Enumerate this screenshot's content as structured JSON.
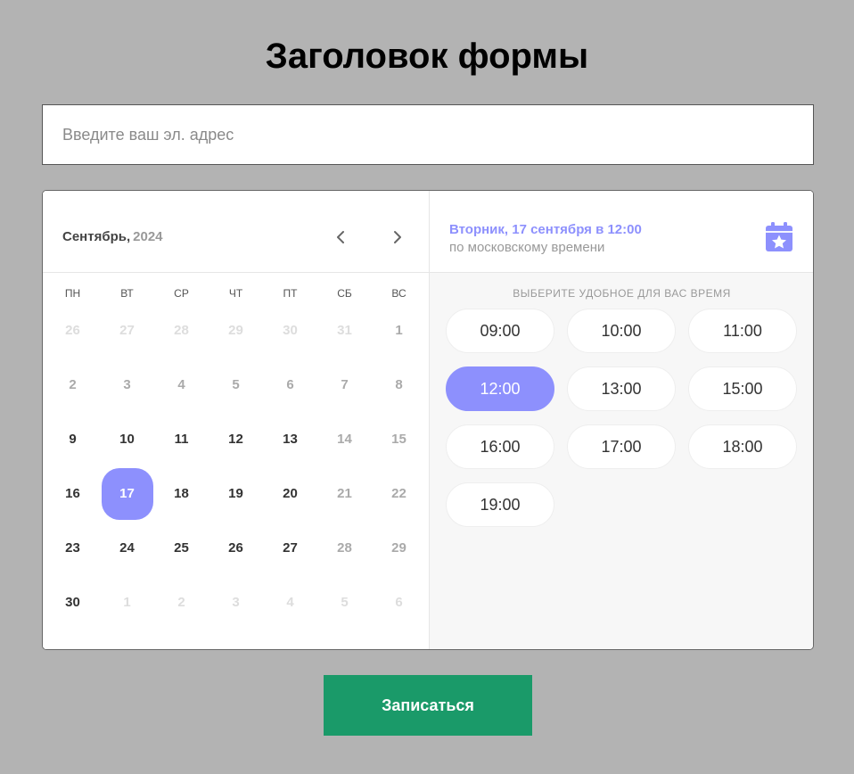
{
  "form": {
    "title": "Заголовок формы",
    "email_placeholder": "Введите ваш эл. адрес",
    "submit_label": "Записаться"
  },
  "calendar": {
    "month": "Сентябрь,",
    "year": "2024",
    "weekdays": [
      "ПН",
      "ВТ",
      "СР",
      "ЧТ",
      "ПТ",
      "СБ",
      "ВС"
    ],
    "days": [
      {
        "d": "26",
        "s": "faint"
      },
      {
        "d": "27",
        "s": "faint"
      },
      {
        "d": "28",
        "s": "faint"
      },
      {
        "d": "29",
        "s": "faint"
      },
      {
        "d": "30",
        "s": "faint"
      },
      {
        "d": "31",
        "s": "faint"
      },
      {
        "d": "1",
        "s": "dim"
      },
      {
        "d": "2",
        "s": "dim"
      },
      {
        "d": "3",
        "s": "dim"
      },
      {
        "d": "4",
        "s": "dim"
      },
      {
        "d": "5",
        "s": "dim"
      },
      {
        "d": "6",
        "s": "dim"
      },
      {
        "d": "7",
        "s": "dim"
      },
      {
        "d": "8",
        "s": "dim"
      },
      {
        "d": "9",
        "s": "normal"
      },
      {
        "d": "10",
        "s": "normal"
      },
      {
        "d": "11",
        "s": "normal"
      },
      {
        "d": "12",
        "s": "normal"
      },
      {
        "d": "13",
        "s": "normal"
      },
      {
        "d": "14",
        "s": "dim"
      },
      {
        "d": "15",
        "s": "dim"
      },
      {
        "d": "16",
        "s": "normal"
      },
      {
        "d": "17",
        "s": "selected"
      },
      {
        "d": "18",
        "s": "normal"
      },
      {
        "d": "19",
        "s": "normal"
      },
      {
        "d": "20",
        "s": "normal"
      },
      {
        "d": "21",
        "s": "dim"
      },
      {
        "d": "22",
        "s": "dim"
      },
      {
        "d": "23",
        "s": "normal"
      },
      {
        "d": "24",
        "s": "normal"
      },
      {
        "d": "25",
        "s": "normal"
      },
      {
        "d": "26",
        "s": "normal"
      },
      {
        "d": "27",
        "s": "normal"
      },
      {
        "d": "28",
        "s": "dim"
      },
      {
        "d": "29",
        "s": "dim"
      },
      {
        "d": "30",
        "s": "normal"
      },
      {
        "d": "1",
        "s": "faint"
      },
      {
        "d": "2",
        "s": "faint"
      },
      {
        "d": "3",
        "s": "faint"
      },
      {
        "d": "4",
        "s": "faint"
      },
      {
        "d": "5",
        "s": "faint"
      },
      {
        "d": "6",
        "s": "faint"
      }
    ],
    "prev_icon": "chevron-left-icon",
    "next_icon": "chevron-right-icon"
  },
  "time": {
    "selected_date": "Вторник, 17 сентября в 12:00",
    "timezone": "по московскому времени",
    "hint": "ВЫБЕРИТЕ УДОБНОЕ ДЛЯ ВАС ВРЕМЯ",
    "calendar_icon": "calendar-star-icon",
    "slots": [
      "09:00",
      "10:00",
      "11:00",
      "12:00",
      "13:00",
      "15:00",
      "16:00",
      "17:00",
      "18:00",
      "19:00"
    ],
    "selected_slot": "12:00"
  },
  "colors": {
    "accent": "#8d90fd",
    "submit": "#1a9a69",
    "background": "#b3b3b3"
  }
}
